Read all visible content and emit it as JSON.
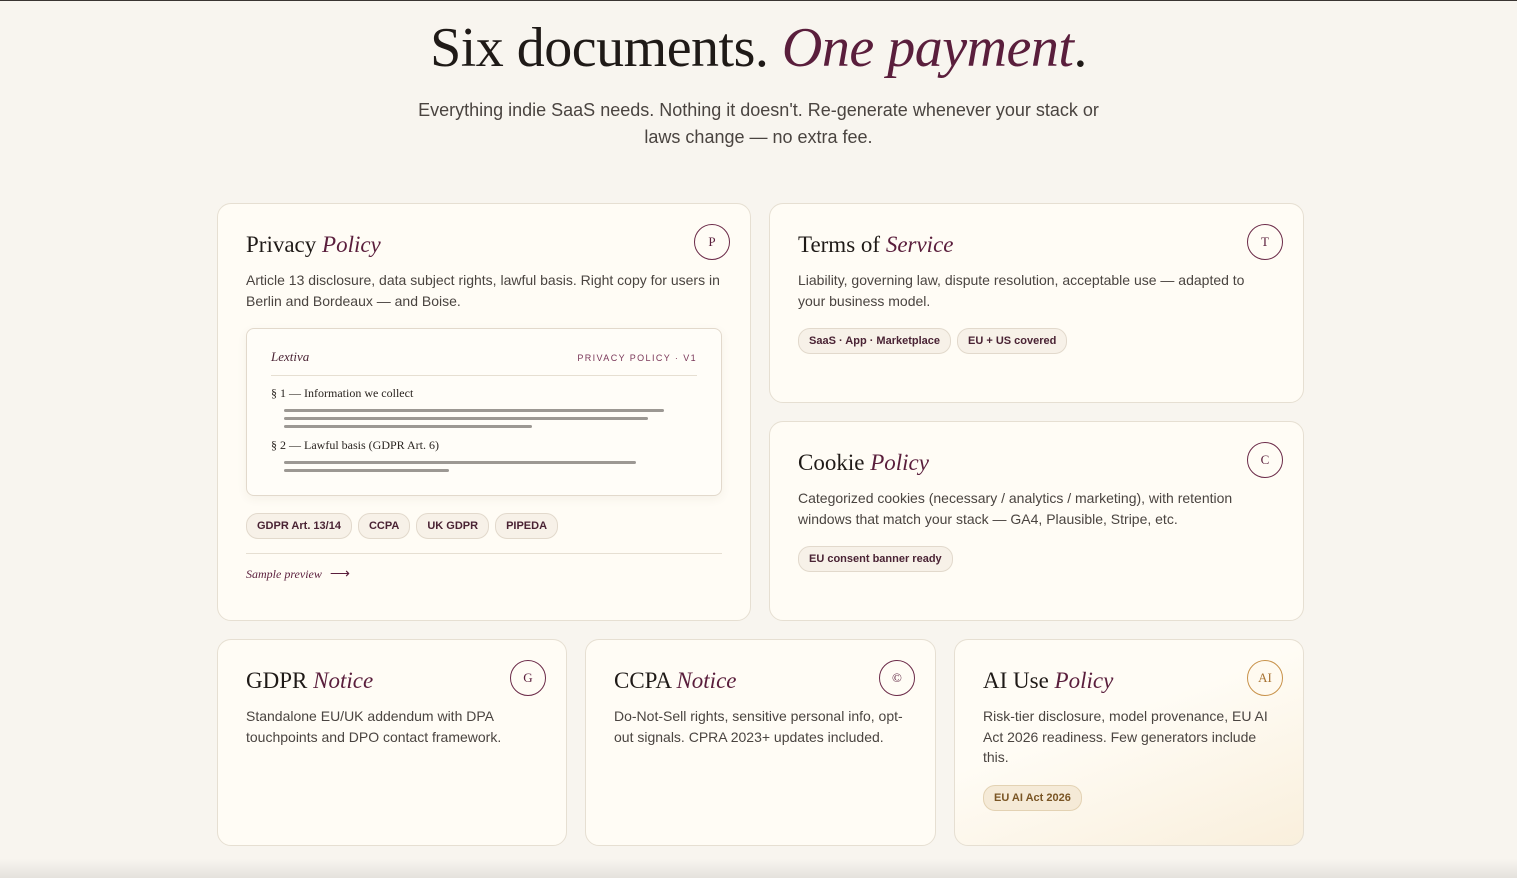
{
  "hero": {
    "title_main": "Six documents.",
    "title_accent": "One payment",
    "title_end": ".",
    "subtitle": "Everything indie SaaS needs. Nothing it doesn't. Re-generate whenever your stack or laws change — no extra fee."
  },
  "cards": {
    "privacy": {
      "title_main": "Privacy",
      "title_accent": "Policy",
      "badge": "P",
      "desc": "Article 13 disclosure, data subject rights, lawful basis. Right copy for users in Berlin and Bordeaux — and Boise.",
      "preview": {
        "brand": "Lextiva",
        "label": "PRIVACY POLICY · V1",
        "section1": "§ 1 — Information we collect",
        "section2": "§ 2 — Lawful basis (GDPR Art. 6)"
      },
      "tags": [
        "GDPR Art. 13/14",
        "CCPA",
        "UK GDPR",
        "PIPEDA"
      ],
      "link": "Sample preview",
      "link_arrow": "⟶"
    },
    "terms": {
      "title_main": "Terms of",
      "title_accent": "Service",
      "badge": "T",
      "desc": "Liability, governing law, dispute resolution, acceptable use — adapted to your business model.",
      "tags": [
        "SaaS · App · Marketplace",
        "EU + US covered"
      ]
    },
    "cookie": {
      "title_main": "Cookie",
      "title_accent": "Policy",
      "badge": "C",
      "desc": "Categorized cookies (necessary / analytics / marketing), with retention windows that match your stack — GA4, Plausible, Stripe, etc.",
      "tags": [
        "EU consent banner ready"
      ]
    },
    "gdpr": {
      "title_main": "GDPR",
      "title_accent": "Notice",
      "badge": "G",
      "desc": "Standalone EU/UK addendum with DPA touchpoints and DPO contact framework."
    },
    "ccpa": {
      "title_main": "CCPA",
      "title_accent": "Notice",
      "badge": "©",
      "desc": "Do-Not-Sell rights, sensitive personal info, opt-out signals. CPRA 2023+ updates included."
    },
    "ai": {
      "title_main": "AI Use",
      "title_accent": "Policy",
      "badge": "AI",
      "desc": "Risk-tier disclosure, model provenance, EU AI Act 2026 readiness. Few generators include this.",
      "tags": [
        "EU AI Act 2026"
      ]
    }
  },
  "colors": {
    "background": "#f8f5ef",
    "accent": "#5a1e3c",
    "gold": "#a87333"
  }
}
